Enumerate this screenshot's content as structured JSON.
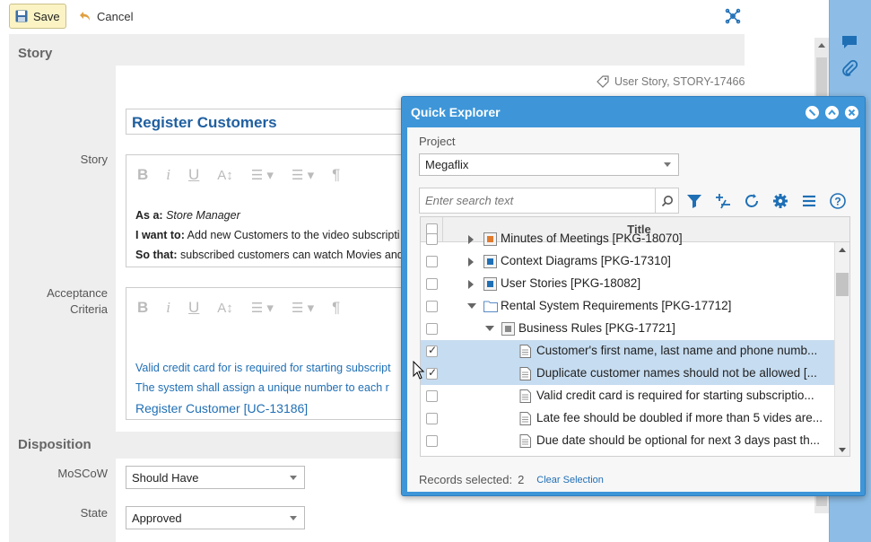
{
  "toolbar": {
    "save_label": "Save",
    "cancel_label": "Cancel"
  },
  "form": {
    "section_story": "Story",
    "item_type": "User Story, STORY-17466",
    "title_value": "Register Customers",
    "story_label": "Story",
    "story_lines": [
      {
        "prefix": "As a:",
        "text": "Store Manager"
      },
      {
        "prefix": "I want to:",
        "text": "Add new Customers to the video subscripti"
      },
      {
        "prefix": "So that:",
        "text": "subscribed customers can watch Movies and"
      }
    ],
    "acceptance_label_1": "Acceptance",
    "acceptance_label_2": "Criteria",
    "acceptance_lines": [
      "Valid credit card for is required for starting subscript",
      "The system shall assign a unique number to each r"
    ],
    "acceptance_link": "Register Customer [UC-13186]",
    "section_disposition": "Disposition",
    "moscow_label": "MoSCoW",
    "moscow_value": "Should Have",
    "state_label": "State",
    "state_value": "Approved"
  },
  "quick_explorer": {
    "title": "Quick Explorer",
    "project_label": "Project",
    "project_value": "Megaflix",
    "search_placeholder": "Enter search text",
    "column_title": "Title",
    "rows": [
      {
        "title": "Minutes of Meetings [PKG-18070]",
        "checked": false,
        "selected": false,
        "kind": "folder"
      },
      {
        "title": "Context Diagrams [PKG-17310]",
        "checked": false,
        "selected": false,
        "kind": "folder"
      },
      {
        "title": "User Stories [PKG-18082]",
        "checked": false,
        "selected": false,
        "kind": "folder"
      },
      {
        "title": "Rental System Requirements [PKG-17712]",
        "checked": false,
        "selected": false,
        "kind": "folder"
      },
      {
        "title": "Business Rules [PKG-17721]",
        "checked": false,
        "selected": false,
        "kind": "folder"
      },
      {
        "title": "Customer's first name, last name and phone numb...",
        "checked": true,
        "selected": true,
        "kind": "doc"
      },
      {
        "title": "Duplicate customer names should not be allowed [...",
        "checked": true,
        "selected": true,
        "kind": "doc"
      },
      {
        "title": "Valid credit card is required for starting subscriptio...",
        "checked": false,
        "selected": false,
        "kind": "doc"
      },
      {
        "title": "Late fee should be doubled if more than 5 vides are...",
        "checked": false,
        "selected": false,
        "kind": "doc"
      },
      {
        "title": "Due date should be optional for next 3 days past th...",
        "checked": false,
        "selected": false,
        "kind": "doc"
      }
    ],
    "records_selected_label": "Records selected:",
    "records_selected_count": "2",
    "clear_selection": "Clear Selection"
  },
  "colors": {
    "accent": "#3e96d8",
    "link": "#1f5fa0",
    "selected_row": "#c6dcf0",
    "save_bg": "#fbf3c4"
  }
}
